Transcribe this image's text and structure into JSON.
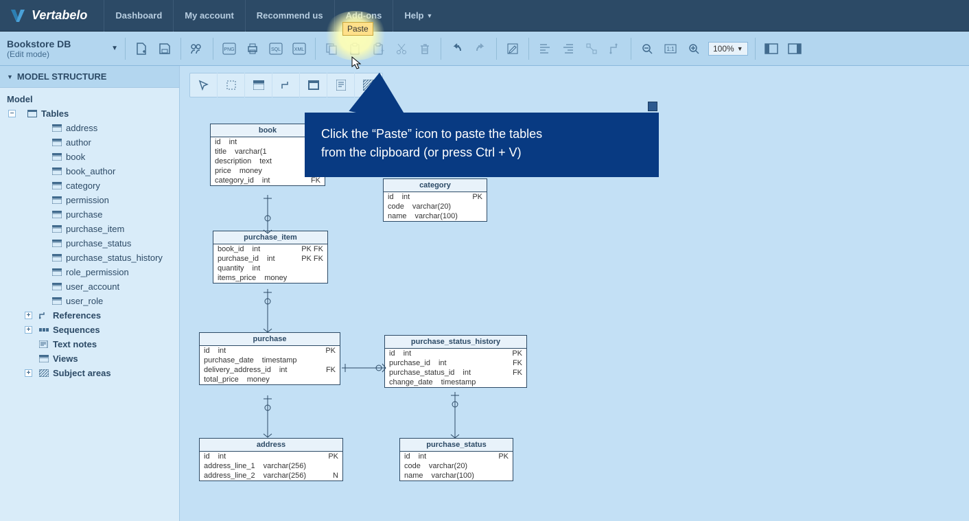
{
  "app": {
    "brand": "Vertabelo"
  },
  "nav": {
    "dashboard": "Dashboard",
    "myaccount": "My account",
    "recommend": "Recommend us",
    "addons": "Add-ons",
    "help": "Help"
  },
  "toolbar": {
    "model_name": "Bookstore DB",
    "model_mode": "(Edit mode)",
    "zoom": "100%"
  },
  "sidebar": {
    "header": "MODEL STRUCTURE",
    "root": "Model",
    "tables_label": "Tables",
    "tables": [
      "address",
      "author",
      "book",
      "book_author",
      "category",
      "permission",
      "purchase",
      "purchase_item",
      "purchase_status",
      "purchase_status_history",
      "role_permission",
      "user_account",
      "user_role"
    ],
    "references": "References",
    "sequences": "Sequences",
    "textnotes": "Text notes",
    "views": "Views",
    "subjectareas": "Subject areas"
  },
  "diagram": {
    "book": {
      "name": "book",
      "cols": [
        [
          "id",
          "int",
          ""
        ],
        [
          "title",
          "varchar(1",
          ""
        ],
        [
          "description",
          "text",
          ""
        ],
        [
          "price",
          "money",
          ""
        ],
        [
          "category_id",
          "int",
          "FK"
        ]
      ]
    },
    "category": {
      "name": "category",
      "cols": [
        [
          "id",
          "int",
          "PK"
        ],
        [
          "code",
          "varchar(20)",
          ""
        ],
        [
          "name",
          "varchar(100)",
          ""
        ]
      ]
    },
    "purchase_item": {
      "name": "purchase_item",
      "cols": [
        [
          "book_id",
          "int",
          "PK FK"
        ],
        [
          "purchase_id",
          "int",
          "PK FK"
        ],
        [
          "quantity",
          "int",
          ""
        ],
        [
          "items_price",
          "money",
          ""
        ]
      ]
    },
    "purchase": {
      "name": "purchase",
      "cols": [
        [
          "id",
          "int",
          "PK"
        ],
        [
          "purchase_date",
          "timestamp",
          ""
        ],
        [
          "delivery_address_id",
          "int",
          "FK"
        ],
        [
          "total_price",
          "money",
          ""
        ]
      ]
    },
    "psh": {
      "name": "purchase_status_history",
      "cols": [
        [
          "id",
          "int",
          "PK"
        ],
        [
          "purchase_id",
          "int",
          "FK"
        ],
        [
          "purchase_status_id",
          "int",
          "FK"
        ],
        [
          "change_date",
          "timestamp",
          ""
        ]
      ]
    },
    "address": {
      "name": "address",
      "cols": [
        [
          "id",
          "int",
          "PK"
        ],
        [
          "address_line_1",
          "varchar(256)",
          ""
        ],
        [
          "address_line_2",
          "varchar(256)",
          "N"
        ]
      ]
    },
    "purchase_status": {
      "name": "purchase_status",
      "cols": [
        [
          "id",
          "int",
          "PK"
        ],
        [
          "code",
          "varchar(20)",
          ""
        ],
        [
          "name",
          "varchar(100)",
          ""
        ]
      ]
    }
  },
  "tooltip": {
    "paste": "Paste"
  },
  "callout": {
    "line1": "Click the “Paste” icon to paste the tables",
    "line2": "from the clipboard (or press Ctrl + V)"
  }
}
